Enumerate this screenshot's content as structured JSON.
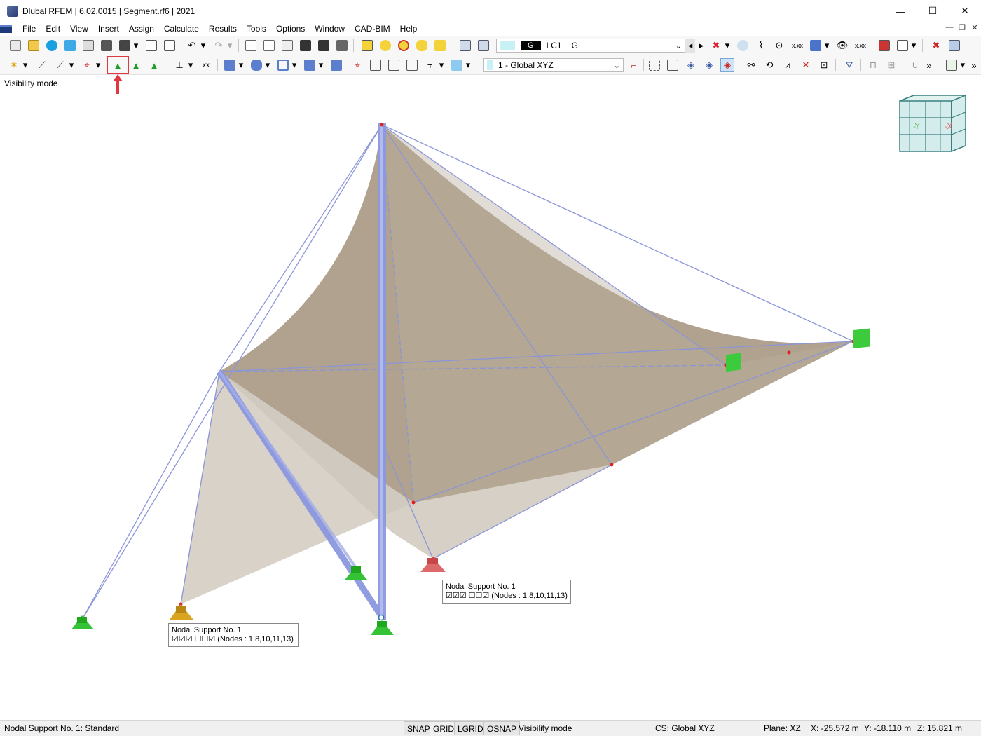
{
  "window": {
    "title": "Dlubal RFEM | 6.02.0015 | Segment.rf6 | 2021",
    "minimize": "—",
    "maximize": "☐",
    "close": "✕"
  },
  "menu": {
    "items": [
      "File",
      "Edit",
      "View",
      "Insert",
      "Assign",
      "Calculate",
      "Results",
      "Tools",
      "Options",
      "Window",
      "CAD-BIM",
      "Help"
    ]
  },
  "toolbar": {
    "load_case_tag": "G",
    "load_case_id": "LC1",
    "load_case_name": "G",
    "coordinate_system": "1 - Global XYZ"
  },
  "viewport": {
    "mode_label": "Visibility mode",
    "view_cube": {
      "left_face": "-Y",
      "right_face": "-X"
    },
    "tooltips": [
      {
        "title": "Nodal Support No. 1",
        "detail": "☑☑☑ ☐☐☑ (Nodes : 1,8,10,11,13)"
      },
      {
        "title": "Nodal Support No. 1",
        "detail": "☑☑☑ ☐☐☑ (Nodes : 1,8,10,11,13)"
      }
    ]
  },
  "status": {
    "left": "Nodal Support No. 1: Standard",
    "toggles": [
      "SNAP",
      "GRID",
      "LGRID",
      "OSNAP"
    ],
    "mode": "Visibility mode",
    "cs": "CS: Global XYZ",
    "plane": "Plane: XZ",
    "x": "X: -25.572 m",
    "y": "Y: -18.110 m",
    "z": "Z: 15.821 m"
  },
  "colors": {
    "membrane": "#b5a894",
    "member": "#8c98e0",
    "cable": "#8a95d8",
    "support_green": "#2fb52f",
    "support_red": "#d85858",
    "support_yellow": "#d4a017",
    "highlight": "#e0383f"
  }
}
